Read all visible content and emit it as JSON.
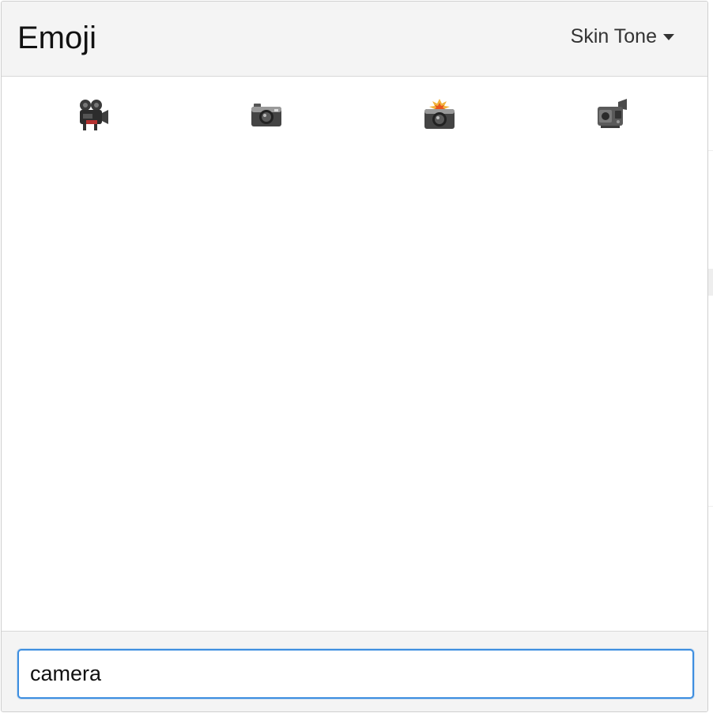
{
  "header": {
    "title": "Emoji",
    "skin_tone_label": "Skin Tone"
  },
  "results": [
    {
      "icon": "movie-camera-icon"
    },
    {
      "icon": "camera-icon"
    },
    {
      "icon": "camera-with-flash-icon"
    },
    {
      "icon": "video-camera-icon"
    }
  ],
  "search": {
    "value": "camera",
    "placeholder": ""
  },
  "colors": {
    "header_bg": "#f4f4f4",
    "focus_border": "#3d8ee0",
    "text": "#111111"
  }
}
